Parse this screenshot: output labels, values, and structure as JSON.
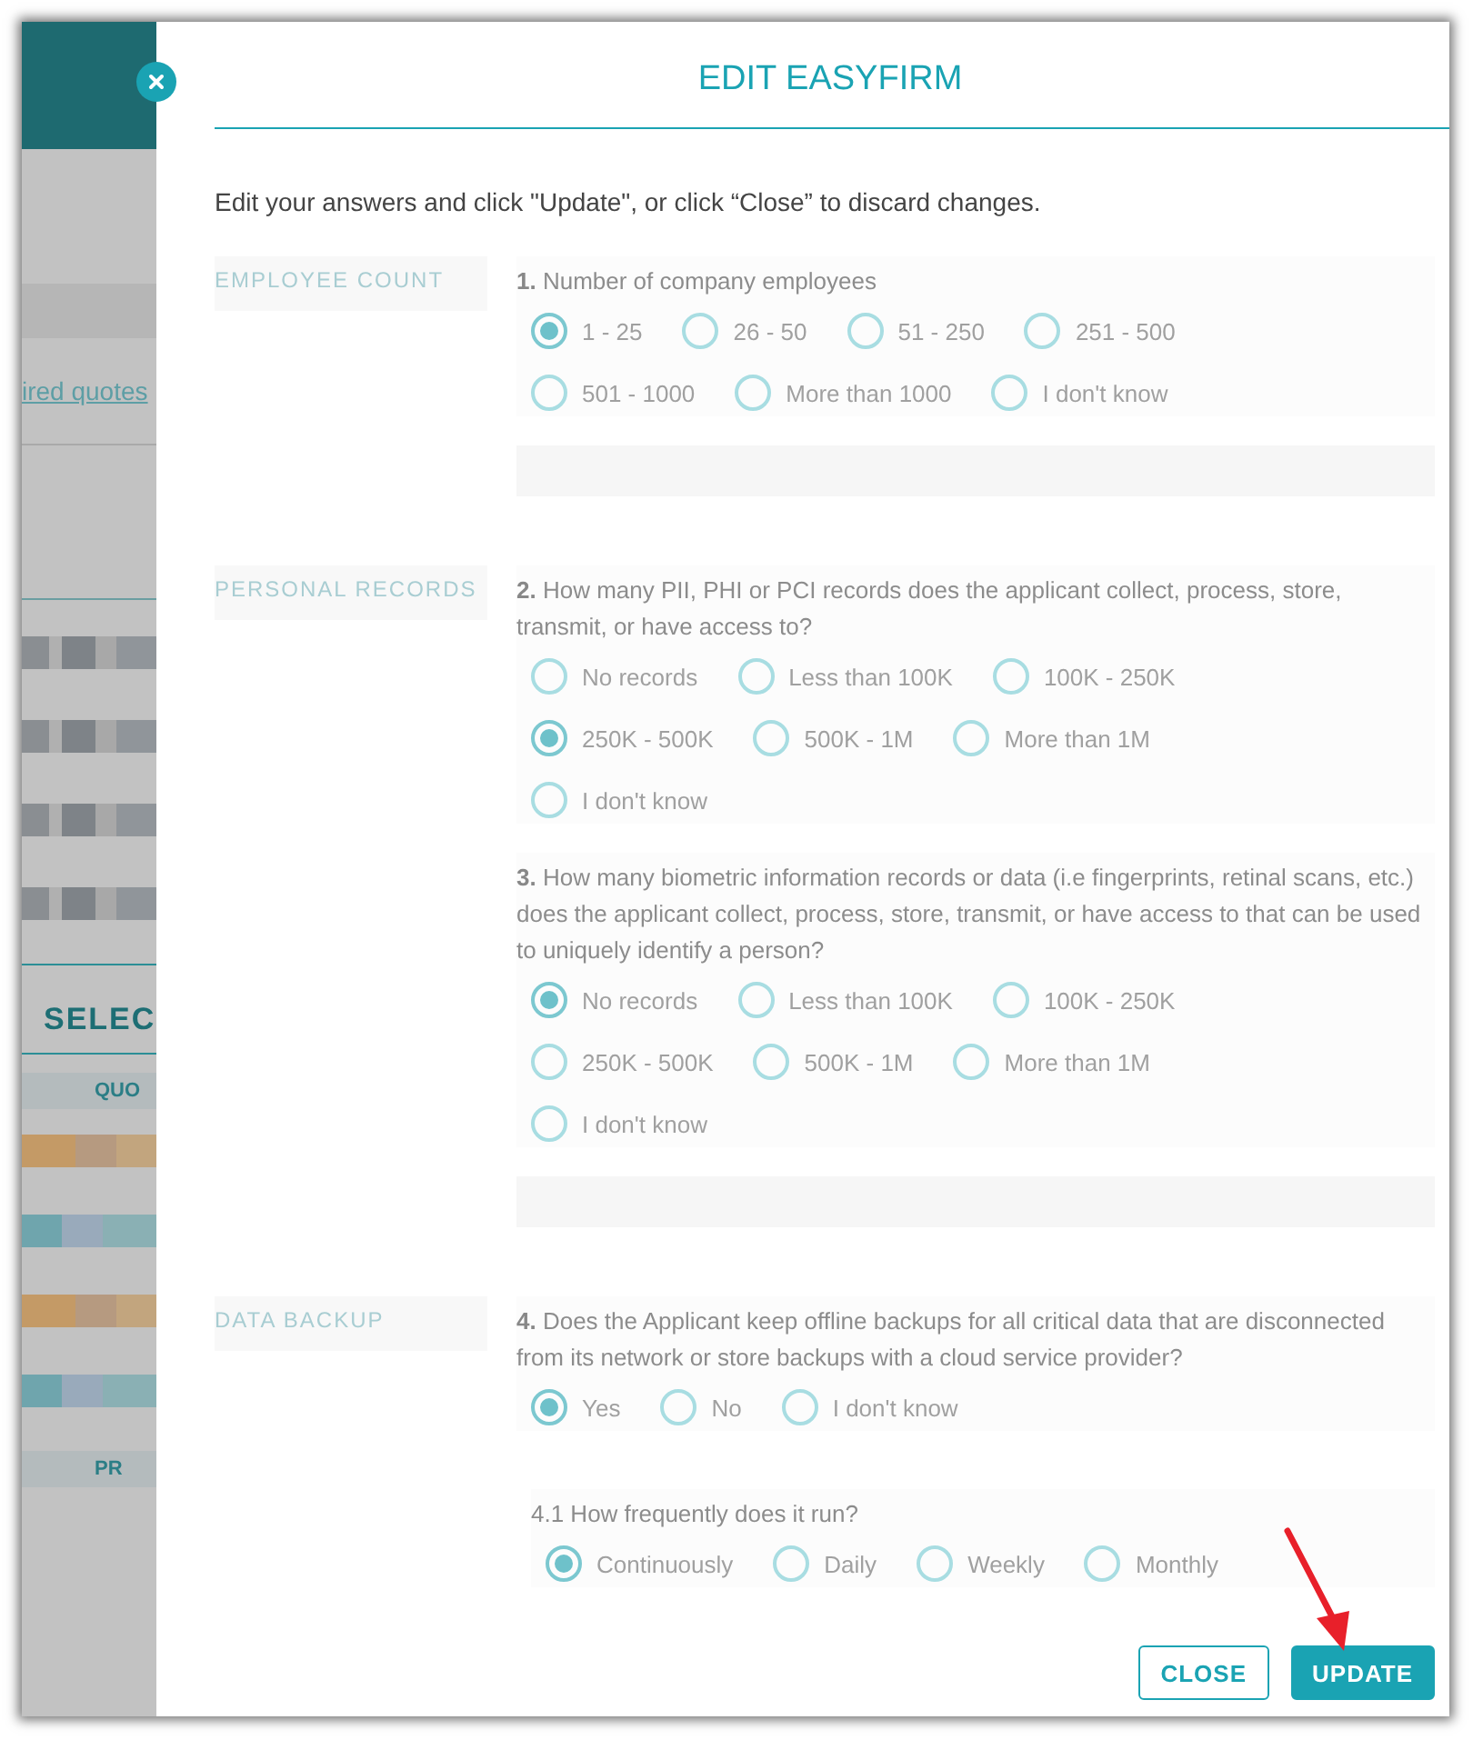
{
  "background": {
    "link": "ired quotes",
    "heading": "SELEC",
    "column_headers": [
      "QUO",
      "PR"
    ]
  },
  "modal": {
    "title": "EDIT EASYFIRM",
    "intro": "Edit your answers and click \"Update\", or click “Close” to discard changes.",
    "sections": [
      {
        "label": "EMPLOYEE COUNT",
        "band_after": true,
        "questions": [
          {
            "kind": "main",
            "number": "1.",
            "text": "Number of company employees",
            "options": [
              {
                "label": "1 - 25",
                "selected": true
              },
              {
                "label": "26 - 50",
                "selected": false
              },
              {
                "label": "51 - 250",
                "selected": false
              },
              {
                "label": "251 - 500",
                "selected": false
              },
              {
                "label": "501 - 1000",
                "selected": false
              },
              {
                "label": "More than 1000",
                "selected": false
              },
              {
                "label": "I don't know",
                "selected": false
              }
            ]
          }
        ]
      },
      {
        "label": "PERSONAL RECORDS",
        "band_after": true,
        "questions": [
          {
            "kind": "main",
            "number": "2.",
            "text": "How many PII, PHI or PCI records does the applicant collect, process, store, transmit, or have access to?",
            "options": [
              {
                "label": "No records",
                "selected": false
              },
              {
                "label": "Less than 100K",
                "selected": false
              },
              {
                "label": "100K - 250K",
                "selected": false
              },
              {
                "label": "250K - 500K",
                "selected": true
              },
              {
                "label": "500K - 1M",
                "selected": false
              },
              {
                "label": "More than 1M",
                "selected": false
              },
              {
                "label": "I don't know",
                "selected": false
              }
            ]
          },
          {
            "kind": "main",
            "number": "3.",
            "text": "How many biometric information records or data (i.e fingerprints, retinal scans, etc.) does the applicant collect, process, store, transmit, or have access to that can be used to uniquely identify a person?",
            "options": [
              {
                "label": "No records",
                "selected": true
              },
              {
                "label": "Less than 100K",
                "selected": false
              },
              {
                "label": "100K - 250K",
                "selected": false
              },
              {
                "label": "250K - 500K",
                "selected": false
              },
              {
                "label": "500K - 1M",
                "selected": false
              },
              {
                "label": "More than 1M",
                "selected": false
              },
              {
                "label": "I don't know",
                "selected": false
              }
            ]
          }
        ]
      },
      {
        "label": "DATA BACKUP",
        "band_after": false,
        "questions": [
          {
            "kind": "main",
            "number": "4.",
            "text": "Does the Applicant keep offline backups for all critical data that are disconnected from its network or store backups with a cloud service provider?",
            "options": [
              {
                "label": "Yes",
                "selected": true
              },
              {
                "label": "No",
                "selected": false
              },
              {
                "label": "I don't know",
                "selected": false
              }
            ]
          },
          {
            "kind": "sub",
            "number": "4.1",
            "text": "How frequently does it run?",
            "options": [
              {
                "label": "Continuously",
                "selected": true
              },
              {
                "label": "Daily",
                "selected": false
              },
              {
                "label": "Weekly",
                "selected": false
              },
              {
                "label": "Monthly",
                "selected": false
              }
            ]
          }
        ]
      }
    ],
    "buttons": [
      {
        "label": "CLOSE",
        "kind": "secondary"
      },
      {
        "label": "UPDATE",
        "kind": "primary"
      }
    ]
  }
}
